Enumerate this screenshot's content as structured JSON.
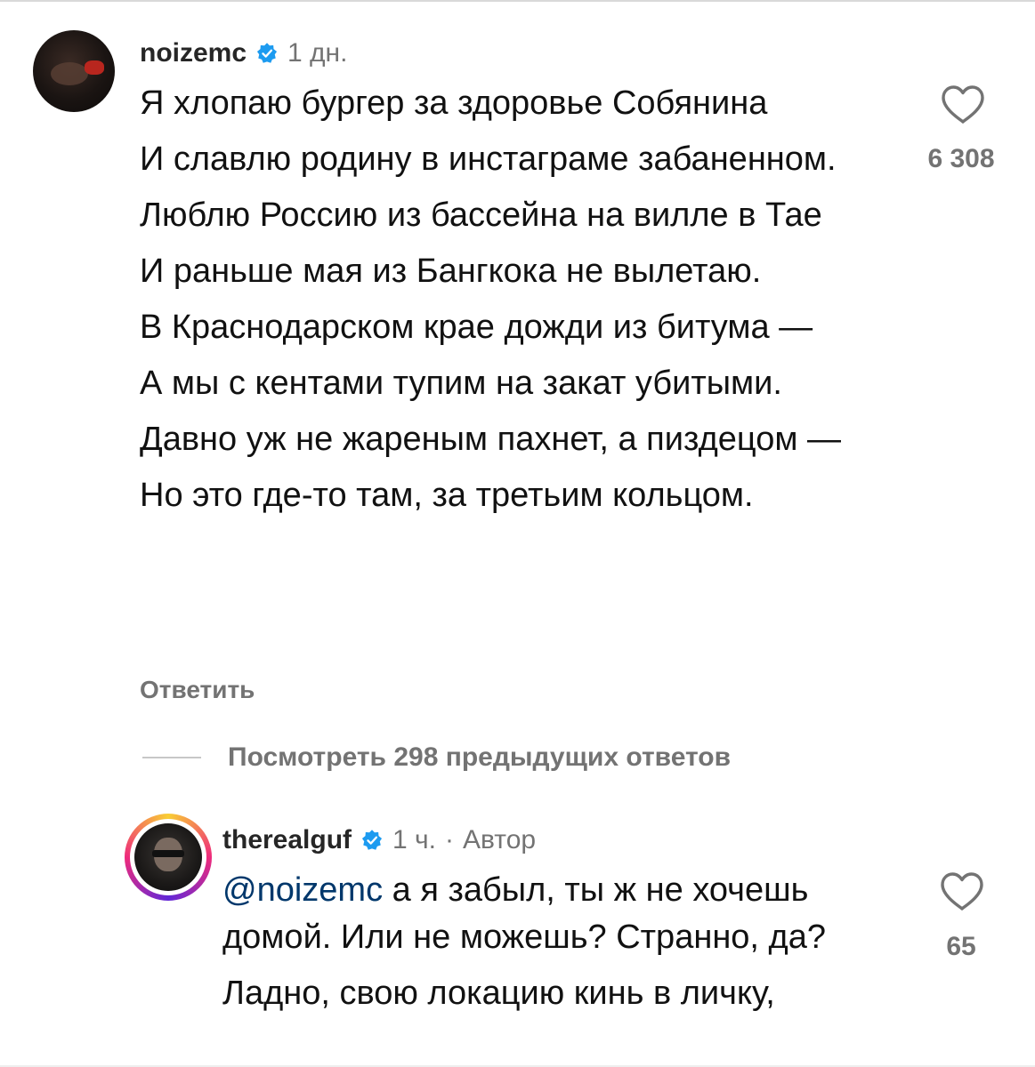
{
  "colors": {
    "text": "#111111",
    "muted": "#737373",
    "username": "#262626",
    "mention": "#00376b",
    "verified_badge": "#1d9bf0"
  },
  "comment1": {
    "username": "noizemc",
    "timestamp": "1 дн.",
    "lines": [
      "Я хлопаю бургер за здоровье Собянина",
      "И славлю родину в инстаграме забаненном.",
      "Люблю Россию из бассейна на вилле в Тае",
      "И раньше мая из Бангкока не вылетаю.",
      "В Краснодарском крае дожди из битума —",
      "А мы с кентами тупим на закат убитыми.",
      "Давно уж не жареным пахнет, а пиздецом —",
      "Но это где-то там, за третьим кольцом."
    ],
    "reply_label": "Ответить",
    "like_count": "6 308"
  },
  "view_previous": "Посмотреть 298 предыдущих ответов",
  "comment2": {
    "username": "therealguf",
    "timestamp": "1 ч.",
    "separator": "·",
    "author_badge": "Автор",
    "mention": "@noizemc",
    "line1_rest": " а я забыл, ты ж не хочешь домой. Или не можешь? Странно, да?",
    "line2": "Ладно, свою локацию кинь в личку,",
    "like_count": "65"
  },
  "icons": {
    "verified": "verified-badge-icon",
    "like": "heart-outline-icon"
  }
}
